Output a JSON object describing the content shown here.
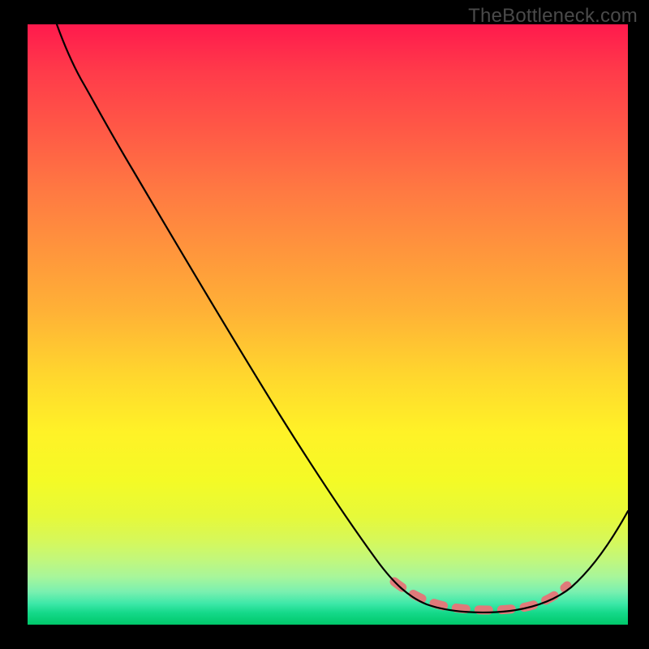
{
  "watermark": "TheBottleneck.com",
  "chart_data": {
    "type": "line",
    "title": "",
    "xlabel": "",
    "ylabel": "",
    "xlim": [
      0,
      100
    ],
    "ylim": [
      0,
      100
    ],
    "background_gradient_stops": [
      {
        "t": 0,
        "color": "#ff1a4d"
      },
      {
        "t": 50,
        "color": "#ffd52e"
      },
      {
        "t": 80,
        "color": "#e6f93a"
      },
      {
        "t": 100,
        "color": "#00c86a"
      }
    ],
    "series": [
      {
        "name": "bottleneck-curve",
        "x": [
          5,
          10,
          15,
          20,
          25,
          30,
          35,
          40,
          45,
          50,
          55,
          60,
          63,
          66.5,
          70,
          73,
          76,
          79,
          82,
          85,
          88,
          91,
          94,
          97,
          100
        ],
        "values": [
          100,
          93,
          86,
          78,
          70,
          62,
          54,
          46,
          38,
          30,
          22,
          15,
          10,
          6,
          4,
          3,
          2.5,
          2.5,
          2.7,
          3.2,
          4.5,
          7,
          11,
          17,
          25
        ]
      }
    ],
    "optimal_band": {
      "name": "optimal-zone",
      "x_start": 64,
      "x_end": 91,
      "y_approx": 3
    }
  }
}
